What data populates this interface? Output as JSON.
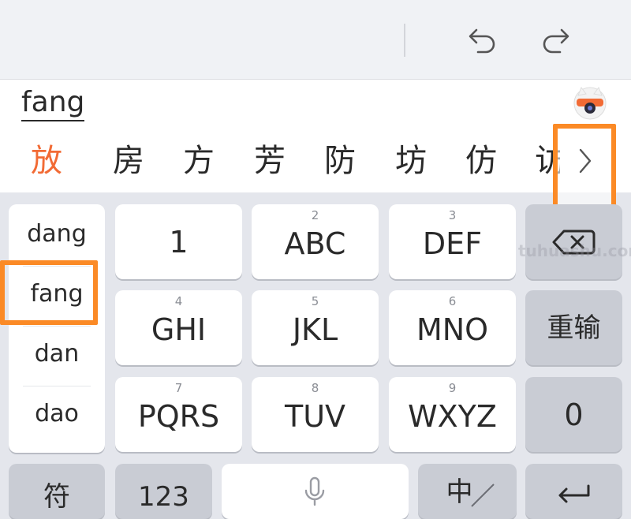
{
  "toolbar": {
    "undo_icon": "undo-icon",
    "redo_icon": "redo-icon"
  },
  "composition": {
    "pinyin": "fang",
    "mascot_icon": "mascot-icon"
  },
  "candidates": [
    "放",
    "房",
    "方",
    "芳",
    "防",
    "坊",
    "仿",
    "访"
  ],
  "more_candidates_icon": "chevron-right-icon",
  "pinyin_options": [
    "dang",
    "fang",
    "dan",
    "dao"
  ],
  "keys": {
    "k1": {
      "label": "1"
    },
    "k2": {
      "num": "2",
      "label": "ABC"
    },
    "k3": {
      "num": "3",
      "label": "DEF"
    },
    "k4": {
      "num": "4",
      "label": "GHI"
    },
    "k5": {
      "num": "5",
      "label": "JKL"
    },
    "k6": {
      "num": "6",
      "label": "MNO"
    },
    "k7": {
      "num": "7",
      "label": "PQRS"
    },
    "k8": {
      "num": "8",
      "label": "TUV"
    },
    "k9": {
      "num": "9",
      "label": "WXYZ"
    },
    "backspace_icon": "backspace-icon",
    "reset": "重输",
    "k0": "0",
    "symbol": "符",
    "numeric": "123",
    "mic_icon": "microphone-icon",
    "lang": "中",
    "enter_icon": "enter-icon"
  },
  "watermark": "tuhuashu.com",
  "colors": {
    "accent_orange": "#fb8a26",
    "candidate_highlight": "#f26b35",
    "keyboard_bg": "#e4e6ec",
    "function_key": "#c9ccd4"
  }
}
